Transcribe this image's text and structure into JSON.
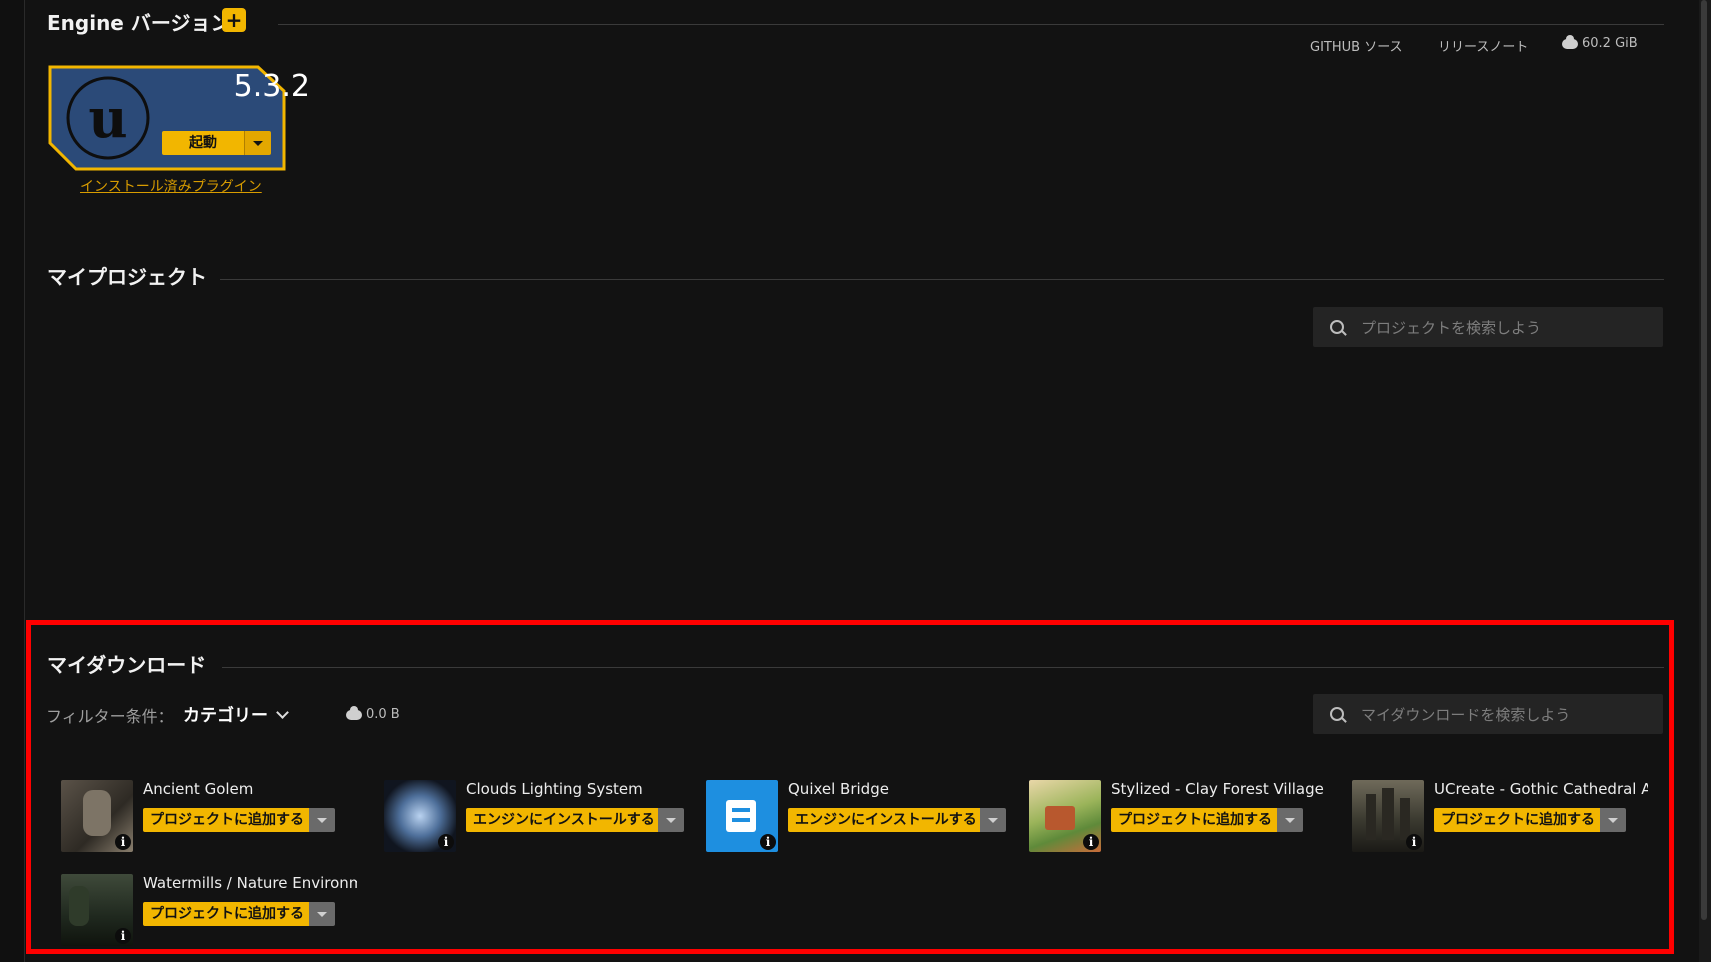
{
  "engine_section": {
    "title": "Engine バージョン",
    "add_icon": "plus-icon",
    "links": {
      "github": "GITHUB ソース",
      "release_notes": "リリースノート",
      "storage": "60.2 GiB"
    },
    "card": {
      "version": "5.3.2",
      "launch_label": "起動",
      "plugins_link": "インストール済みプラグイン",
      "accent": "#f2b600",
      "card_color": "#2b4a78"
    }
  },
  "projects_section": {
    "title": "マイプロジェクト",
    "search_placeholder": "プロジェクトを検索しよう"
  },
  "downloads_section": {
    "title": "マイダウンロード",
    "filter_label": "フィルター条件：",
    "filter_value": "カテゴリー",
    "download_size": "0.0 B",
    "search_placeholder": "マイダウンロードを検索しよう",
    "highlight_color": "#ff0000",
    "assets": [
      {
        "name": "Ancient Golem",
        "action": "プロジェクトに追加する"
      },
      {
        "name": "Clouds Lighting System",
        "action": "エンジンにインストールする"
      },
      {
        "name": "Quixel Bridge",
        "action": "エンジンにインストールする"
      },
      {
        "name": "Stylized - Clay Forest Village",
        "action": "プロジェクトに追加する"
      },
      {
        "name": "UCreate - Gothic Cathedral A",
        "action": "プロジェクトに追加する"
      },
      {
        "name": "Watermills / Nature Environm",
        "action": "プロジェクトに追加する"
      }
    ]
  }
}
